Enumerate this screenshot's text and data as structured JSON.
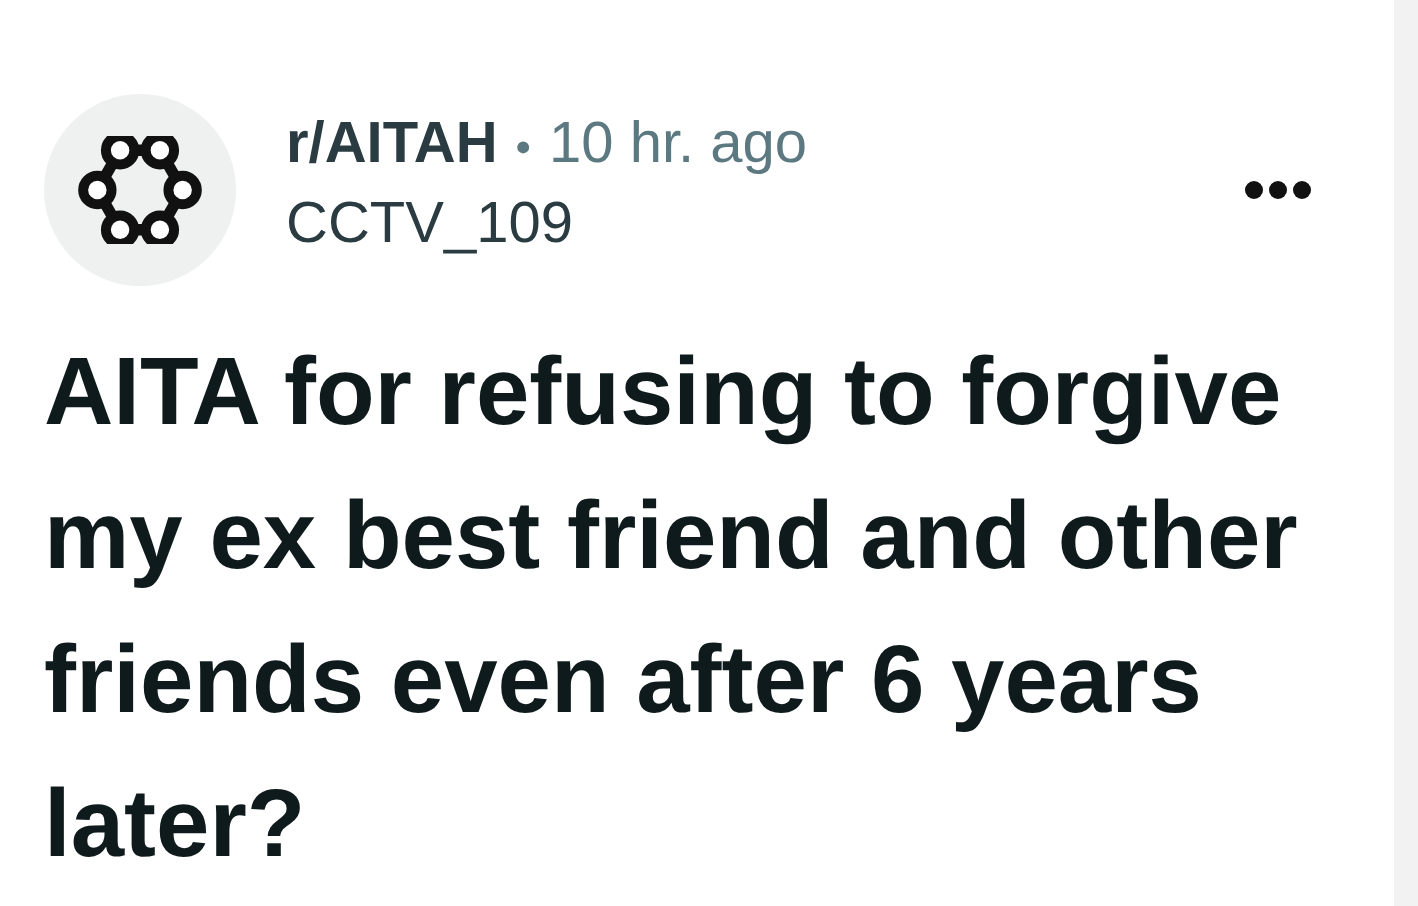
{
  "post": {
    "community": "r/AITAH",
    "separator": "•",
    "time": "10 hr. ago",
    "author": "CCTV_109",
    "title": "AITA for refusing to forgive my ex best friend and other friends even after 6 years later?"
  }
}
